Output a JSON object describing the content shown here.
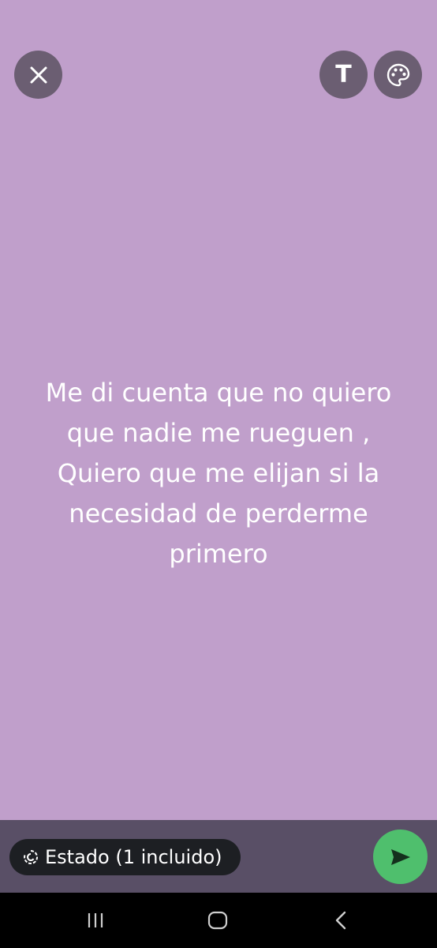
{
  "colors": {
    "background": "#c09fcb",
    "button_bg": "#6b5e72",
    "bottom_bar": "#594f66",
    "pill_bg": "#1d1f23",
    "send_green": "#4fbf6d"
  },
  "toolbar": {
    "close_icon": "close-icon",
    "text_tool_label": "T",
    "palette_icon": "palette-icon"
  },
  "status": {
    "text": "Me di cuenta que no quiero\nque nadie  me rueguen ,\nQuiero que me elijan si la\nnecesidad de perderme\nprimero"
  },
  "footer": {
    "audience_label": "Estado (1 incluido)",
    "audience_icon": "status-ring-icon",
    "send_icon": "send-icon"
  },
  "navigation": {
    "recents_icon": "recents-icon",
    "home_icon": "home-icon",
    "back_icon": "back-icon"
  }
}
